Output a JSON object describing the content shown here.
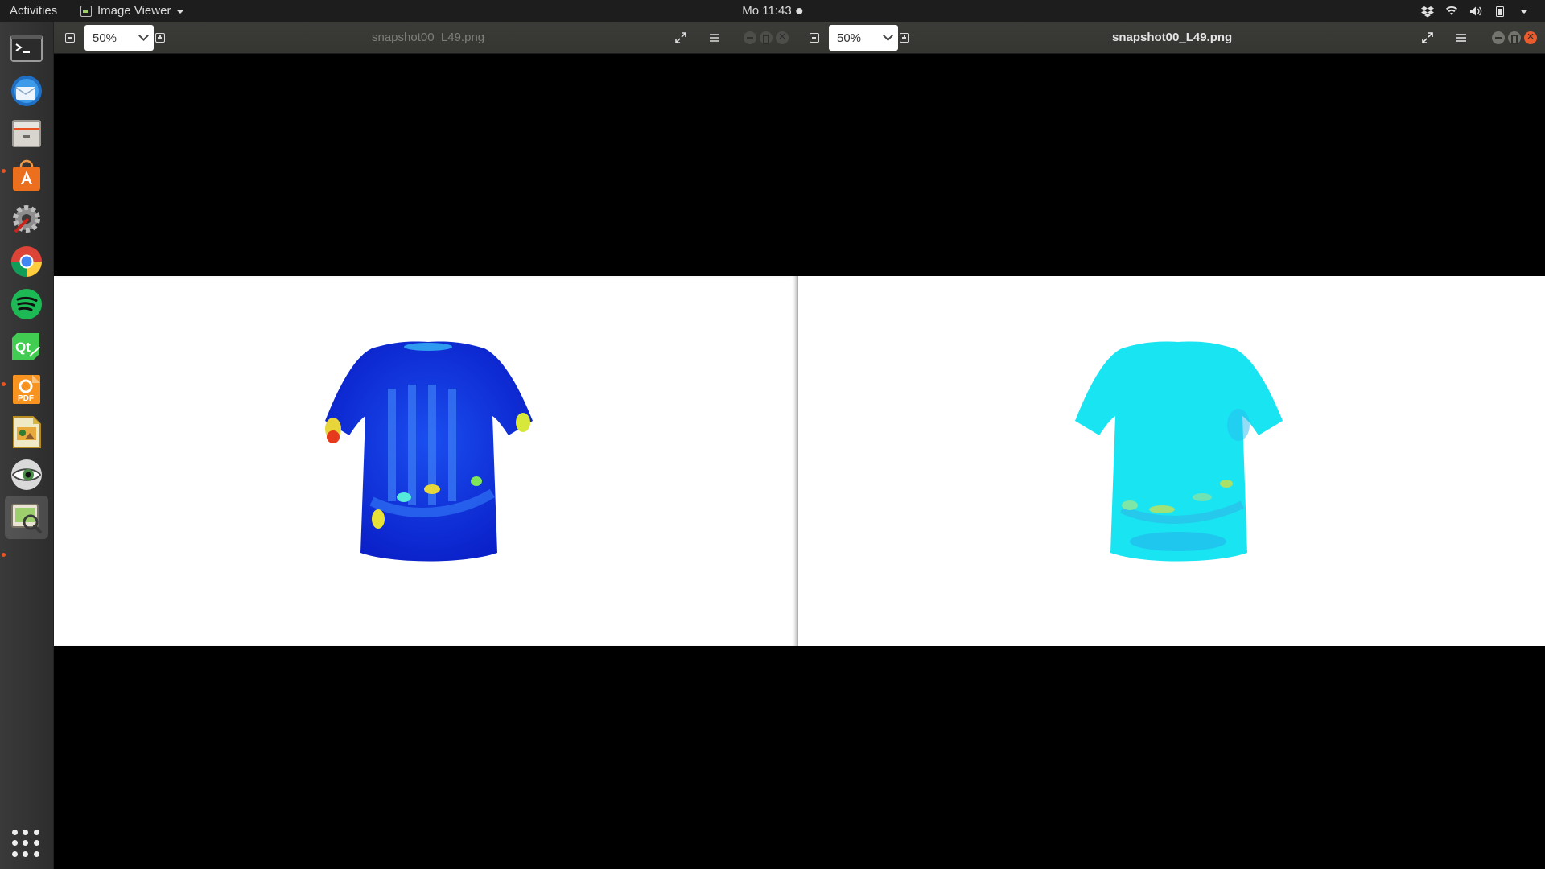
{
  "topbar": {
    "activities": "Activities",
    "app_menu": "Image Viewer",
    "clock": "Mo 11:43",
    "tray_icons": [
      "dropbox-icon",
      "wifi-icon",
      "volume-icon",
      "battery-icon",
      "system-menu-caret-icon"
    ]
  },
  "dock": {
    "items": [
      {
        "name": "terminal",
        "running": false
      },
      {
        "name": "thunderbird-mail",
        "running": false
      },
      {
        "name": "files",
        "running": true
      },
      {
        "name": "software-center",
        "running": false
      },
      {
        "name": "system-settings",
        "running": false
      },
      {
        "name": "chrome",
        "running": false
      },
      {
        "name": "spotify",
        "running": false
      },
      {
        "name": "qt-creator",
        "running": true
      },
      {
        "name": "pdf-reader",
        "running": false
      },
      {
        "name": "libreoffice-impress",
        "running": false
      },
      {
        "name": "eye-app",
        "running": false
      },
      {
        "name": "image-viewer",
        "running": true,
        "active": true
      }
    ],
    "show_apps": "show-applications"
  },
  "windows": {
    "left": {
      "zoom": "50%",
      "title": "snapshot00_L49.png",
      "focused": false
    },
    "right": {
      "zoom": "50%",
      "title": "snapshot00_L49.png",
      "focused": true
    }
  },
  "colors": {
    "topbar": "#1d1d1d",
    "headerbar": "#383835",
    "close_button": "#e85c2d",
    "shirt_left_base": "#1030e0",
    "shirt_right_base": "#19e4f2"
  }
}
